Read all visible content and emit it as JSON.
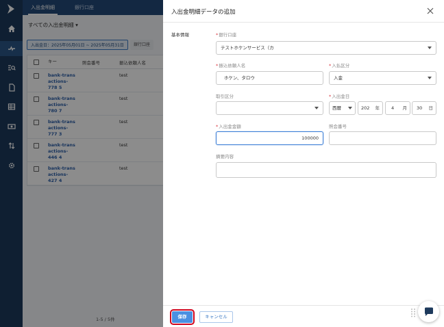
{
  "app": {
    "tabs": [
      {
        "label": "入出金明細"
      },
      {
        "label": "銀行口座"
      }
    ],
    "filter_title": "すべての入出金明細",
    "chips": [
      {
        "label": "入出金日：2025年05月01日 ~ 2025年05月31日"
      },
      {
        "label": "銀行口座"
      }
    ],
    "table": {
      "headers": [
        "キー",
        "照会番号",
        "振込依頼人名"
      ],
      "rows": [
        {
          "key": "bank-trans actions-778 5",
          "ref": "",
          "name": "test"
        },
        {
          "key": "bank-trans actions-780 7",
          "ref": "",
          "name": "test"
        },
        {
          "key": "bank-trans actions-777 3",
          "ref": "",
          "name": "test"
        },
        {
          "key": "bank-trans actions-446 4",
          "ref": "",
          "name": "test"
        },
        {
          "key": "bank-trans actions-427 4",
          "ref": "",
          "name": "test"
        }
      ]
    },
    "pager": "1-5 / 5件"
  },
  "drawer": {
    "title": "入出金明細データの追加",
    "section": "基本情報",
    "fields": {
      "bank_account": {
        "label": "銀行口座",
        "required": "*",
        "value": "テストホケンサービス（カ"
      },
      "payer_name": {
        "label": "振込依頼人名",
        "required": "*",
        "value": "ホケン、タロウ"
      },
      "in_out": {
        "label": "入払区分",
        "required": "*",
        "value": "入金"
      },
      "txn_type": {
        "label": "取引区分",
        "value": ""
      },
      "date": {
        "label": "入出金日",
        "required": "*",
        "era": "西暦",
        "year": "202",
        "year_unit": "年",
        "month": "4",
        "month_unit": "月",
        "day": "30",
        "day_unit": "日"
      },
      "amount": {
        "label": "入出金金額",
        "required": "*",
        "value": "100000"
      },
      "ref_no": {
        "label": "照会番号",
        "value": ""
      },
      "memo": {
        "label": "摘要内容",
        "value": ""
      }
    },
    "buttons": {
      "save": "保存",
      "cancel": "キャンセル"
    }
  },
  "colors": {
    "rail": "#1d3a5c",
    "topbar": "#234a78",
    "primary": "#4a90e2",
    "required": "#d9363e",
    "highlight": "#d0021b"
  },
  "icons": [
    "logo-icon",
    "home-icon",
    "transactions-icon",
    "search-list-icon",
    "document-icon",
    "table-icon",
    "money-icon",
    "transfer-icon",
    "settings-icon",
    "close-icon",
    "chat-icon"
  ]
}
